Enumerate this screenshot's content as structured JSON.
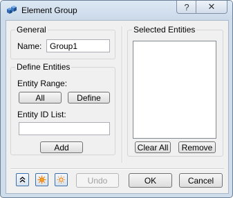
{
  "window": {
    "title": "Element Group",
    "help_glyph": "?",
    "close_glyph": "✕"
  },
  "general": {
    "legend": "General",
    "name_label": "Name:",
    "name_value": "Group1"
  },
  "define": {
    "legend": "Define Entities",
    "range_label": "Entity Range:",
    "all_label": "All",
    "define_label": "Define",
    "id_list_label": "Entity ID List:",
    "id_list_value": "",
    "add_label": "Add"
  },
  "selected": {
    "legend": "Selected Entities",
    "items": [],
    "clear_all_label": "Clear All",
    "remove_label": "Remove"
  },
  "footer": {
    "undo_label": "Undo",
    "ok_label": "OK",
    "cancel_label": "Cancel"
  },
  "icons": {
    "app": "cubes-icon",
    "collapse": "double-chevron-up-icon",
    "sun_filled": "sun-icon",
    "sun_outline": "sun-outline-icon"
  },
  "colors": {
    "title_bg": "#cfdcea",
    "client_bg": "#f0f0f0",
    "accent_blue": "#3c6ea8",
    "orange": "#f08a1c"
  }
}
